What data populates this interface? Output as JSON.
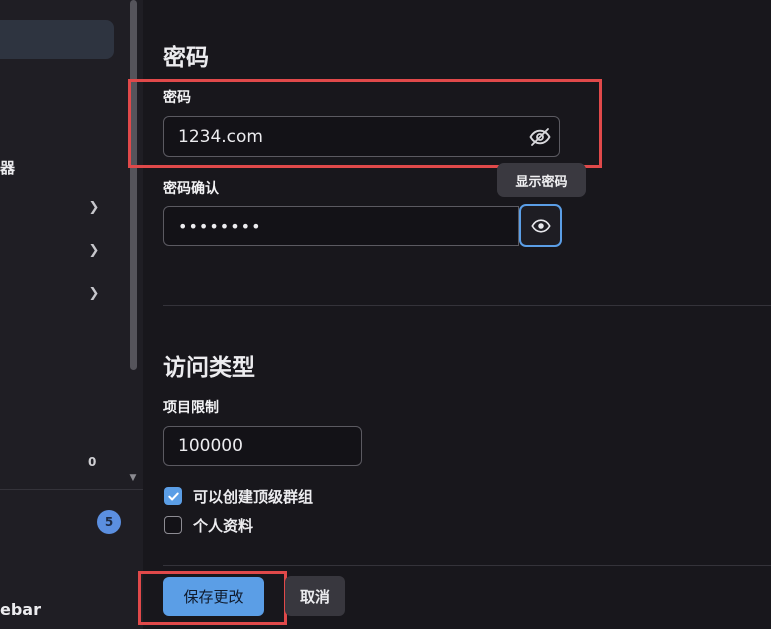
{
  "sidebar": {
    "fragment_text": "器",
    "count": "0",
    "badge": "5",
    "bottom_text": "ebar"
  },
  "password_section": {
    "heading": "密码",
    "password_label": "密码",
    "password_value": "1234.com",
    "confirm_label": "密码确认",
    "confirm_masked": "••••••••",
    "tooltip": "显示密码"
  },
  "access_section": {
    "heading": "访问类型",
    "projects_limit_label": "项目限制",
    "projects_limit_value": "100000",
    "can_create_group_label": "可以创建顶级群组",
    "can_create_group_checked": true,
    "private_profile_label": "个人资料",
    "private_profile_checked": false
  },
  "actions": {
    "save_label": "保存更改",
    "cancel_label": "取消"
  },
  "colors": {
    "accent": "#5b9ee6",
    "annotation_red": "#e0494a",
    "background": "#18171c"
  },
  "icons": [
    "eye-off-icon",
    "eye-icon",
    "chevron-right-icon",
    "checkmark-icon"
  ]
}
